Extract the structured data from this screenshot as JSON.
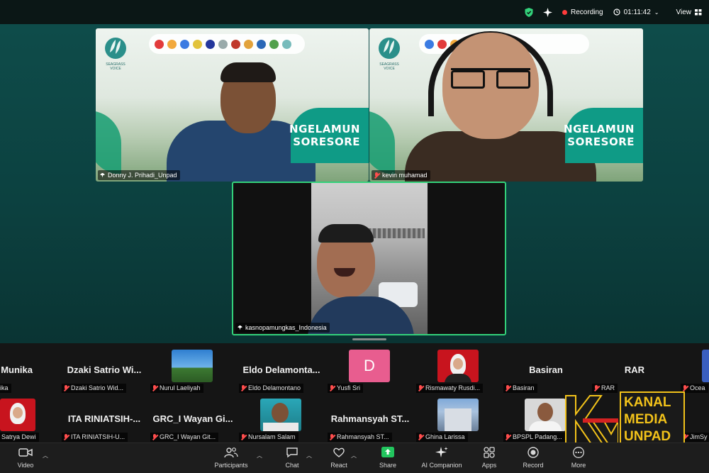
{
  "topbar": {
    "recording_label": "Recording",
    "timer": "01:11:42",
    "view_label": "View"
  },
  "speakers": [
    {
      "name": "Donny J. Prihadi_Unpad",
      "banner_line1": "NGELAMUN",
      "banner_line2": "SORESORE",
      "logo_text": "SEAGRASS VOICE"
    },
    {
      "name": "kevin muhamad",
      "banner_line1": "NGELAMUN",
      "banner_line2": "SORESORE",
      "logo_text": "SEAGRASS VOICE"
    },
    {
      "name": "kasnopamungkas_Indonesia"
    }
  ],
  "gallery": {
    "row1": [
      {
        "big": "Munika",
        "label": "ika",
        "avatar": "none"
      },
      {
        "big": "Dzaki Satrio Wi...",
        "label": "Dzaki Satrio Wid...",
        "avatar": "none"
      },
      {
        "big": "",
        "label": "Nurul Laeliyah",
        "avatar": "photo-sky"
      },
      {
        "big": "Eldo Delamonta...",
        "label": "Eldo Delamontano",
        "avatar": "none"
      },
      {
        "big": "",
        "label": "Yusfi Sri",
        "avatar": "letter",
        "letter": "D"
      },
      {
        "big": "",
        "label": "Rismawaty Rusdi...",
        "avatar": "photo-hijab-red"
      },
      {
        "big": "Basiran",
        "label": "Basiran",
        "avatar": "none"
      },
      {
        "big": "RAR",
        "label": "RAR",
        "avatar": "none"
      },
      {
        "big": "",
        "label": "Ocea",
        "avatar": "photo-blue"
      }
    ],
    "row2": [
      {
        "big": "",
        "label": "Satrya Dewi",
        "avatar": "photo-hijab-red"
      },
      {
        "big": "ITA RINIATSIH-...",
        "label": "ITA RINIATSIH-U...",
        "avatar": "none"
      },
      {
        "big": "GRC_I Wayan Gi...",
        "label": "GRC_I Wayan Git...",
        "avatar": "none"
      },
      {
        "big": "",
        "label": "Nursalam Salam",
        "avatar": "photo-man-banner"
      },
      {
        "big": "Rahmansyah ST...",
        "label": "Rahmansyah ST...",
        "avatar": "none"
      },
      {
        "big": "",
        "label": "Ghina Larissa",
        "avatar": "photo-building"
      },
      {
        "big": "",
        "label": "BPSPL Padang...",
        "avatar": "photo-man-office"
      },
      {
        "big": "",
        "label": "JimSy",
        "avatar": "none"
      }
    ]
  },
  "toolbar": {
    "video": "Video",
    "participants": "Participants",
    "participants_count": "",
    "chat": "Chat",
    "react": "React",
    "share": "Share",
    "ai": "AI Companion",
    "apps": "Apps",
    "record": "Record",
    "more": "More"
  },
  "watermark": {
    "line1": "KANAL",
    "line2": "MEDIA",
    "line3": "UNPAD",
    "mark": "KMU"
  },
  "colors": {
    "active_speaker_border": "#33d17a",
    "share_green": "#22c55e",
    "muted_red": "#ff4d4d",
    "banner_teal": "#0f9b86",
    "watermark_yellow": "#f2c21a"
  }
}
